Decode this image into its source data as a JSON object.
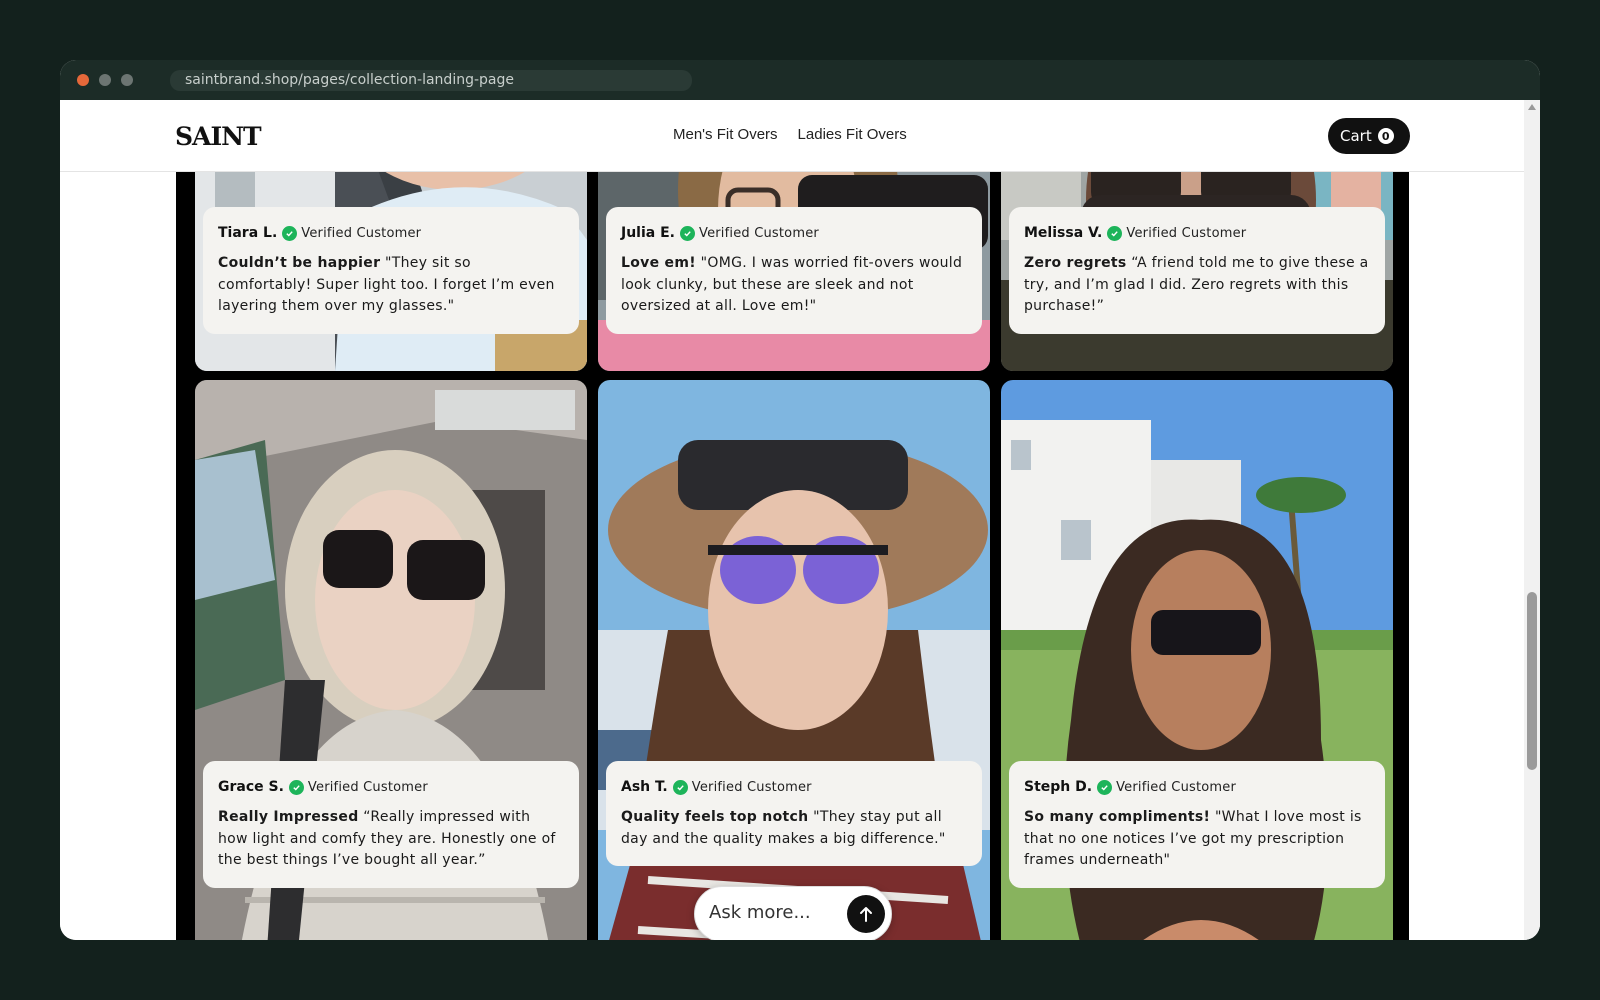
{
  "browser": {
    "url": "saintbrand.shop/pages/collection-landing-page"
  },
  "header": {
    "logo_text": "SAINT",
    "nav": [
      "Men's Fit Overs",
      "Ladies Fit Overs"
    ],
    "cart_label": "Cart",
    "cart_count": "0"
  },
  "reviews": [
    {
      "name": "Tiara L.",
      "verified": "Verified Customer",
      "title": "Couldn’t be happier",
      "text": "\"They sit so comfortably! Super light too. I forget I’m even layering them over my glasses.\""
    },
    {
      "name": "Julia E.",
      "verified": "Verified Customer",
      "title": "Love em!",
      "text": "\"OMG. I was worried fit-overs would look clunky, but these are sleek and not oversized at all. Love em!\""
    },
    {
      "name": "Melissa V.",
      "verified": "Verified Customer",
      "title": "Zero regrets",
      "text": "“A friend told me to give these a try, and I’m glad I did. Zero regrets with this purchase!”"
    },
    {
      "name": "Grace S.",
      "verified": "Verified Customer",
      "title": "Really Impressed",
      "text": "“Really impressed with how light and comfy they are. Honestly one of the best things I’ve bought all year.”"
    },
    {
      "name": "Ash T.",
      "verified": "Verified Customer",
      "title": "Quality feels top notch",
      "text": "\"They stay put all day and the quality makes a big difference.\""
    },
    {
      "name": "Steph D.",
      "verified": "Verified Customer",
      "title": "So many compliments!",
      "text": "\"What I love most is that no one notices I’ve got my prescription frames underneath\""
    }
  ],
  "chat": {
    "placeholder": "Ask more..."
  },
  "colors": {
    "accent_green": "#1db45a",
    "gallery_bg": "#000000",
    "card_bg": "#f4f3f0"
  },
  "icons": [
    "verified-check-icon",
    "arrow-up-icon",
    "scroll-up-arrow-icon"
  ]
}
